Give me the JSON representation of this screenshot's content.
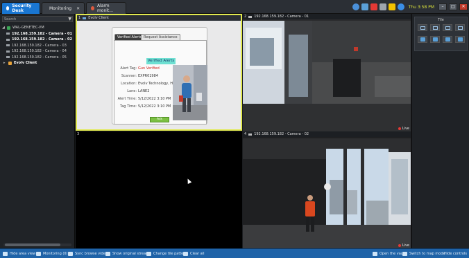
{
  "tabs": [
    {
      "label": "Security Desk",
      "active": true
    },
    {
      "label": "Monitoring",
      "active": false
    },
    {
      "label": "Alarm monit...",
      "active": false
    }
  ],
  "tray": {
    "time": "Thu 3:58 PM"
  },
  "left_panel": {
    "search_placeholder": "Search",
    "tree": [
      {
        "label": "WAL-GENETEC-VM",
        "type": "server"
      },
      {
        "label": "192.168.159.182 - Camera - 01",
        "type": "camera",
        "bold": true
      },
      {
        "label": "192.168.159.182 - Camera - 02",
        "type": "camera",
        "bold": true
      },
      {
        "label": "192.168.159.182 - Camera - 03",
        "type": "camera"
      },
      {
        "label": "192.168.159.182 - Camera - 04",
        "type": "camera"
      },
      {
        "label": "192.168.159.182 - Camera - 05",
        "type": "camera"
      },
      {
        "label": "Evolv Client",
        "type": "folder",
        "bold": true
      }
    ]
  },
  "tiles": {
    "tile1": {
      "number": "1",
      "title": "Evolv Client"
    },
    "tile2": {
      "number": "2",
      "title": "192.168.159.182 - Camera - 01",
      "live": "Live"
    },
    "tile3": {
      "number": "3"
    },
    "tile4": {
      "number": "4",
      "title": "192.168.159.182 - Camera - 02",
      "live": "Live"
    }
  },
  "alert": {
    "tab_active": "Verified Alerts",
    "tab_inactive": "Request Assistance",
    "heading": "Verified Alerts",
    "fields": [
      {
        "label": "Alert Tag:",
        "value": "Gun Verified",
        "highlight": true
      },
      {
        "label": "Scanner:",
        "value": "EXPR01984"
      },
      {
        "label": "Location:",
        "value": "Evolv Technology, HQ"
      },
      {
        "label": "Lane:",
        "value": "LANE2"
      },
      {
        "label": "Alert Time:",
        "value": "5/12/2022 3:10 PM"
      },
      {
        "label": "Tag Time:",
        "value": "5/12/2022 3:10 PM"
      }
    ],
    "ack_label": "Ack"
  },
  "right_panel": {
    "title": "Tile"
  },
  "bottom_bar": {
    "hide_area_view": "Hide area view",
    "monitoring": "Monitoring (0)",
    "sync_video": "Sync browse video",
    "show_streams": "Show original streams",
    "change_pattern": "Change tile pattern",
    "clear_all": "Clear all",
    "open_vault": "Open the vault",
    "map_mode": "Switch to map mode",
    "hide_controls": "Hide controls"
  },
  "colors": {
    "accent": "#1976d2",
    "bottom_bar": "#1f63a8",
    "selection": "#e2ea4e",
    "alert_red": "#d0241e",
    "heading_bg": "#6ee0d2"
  }
}
